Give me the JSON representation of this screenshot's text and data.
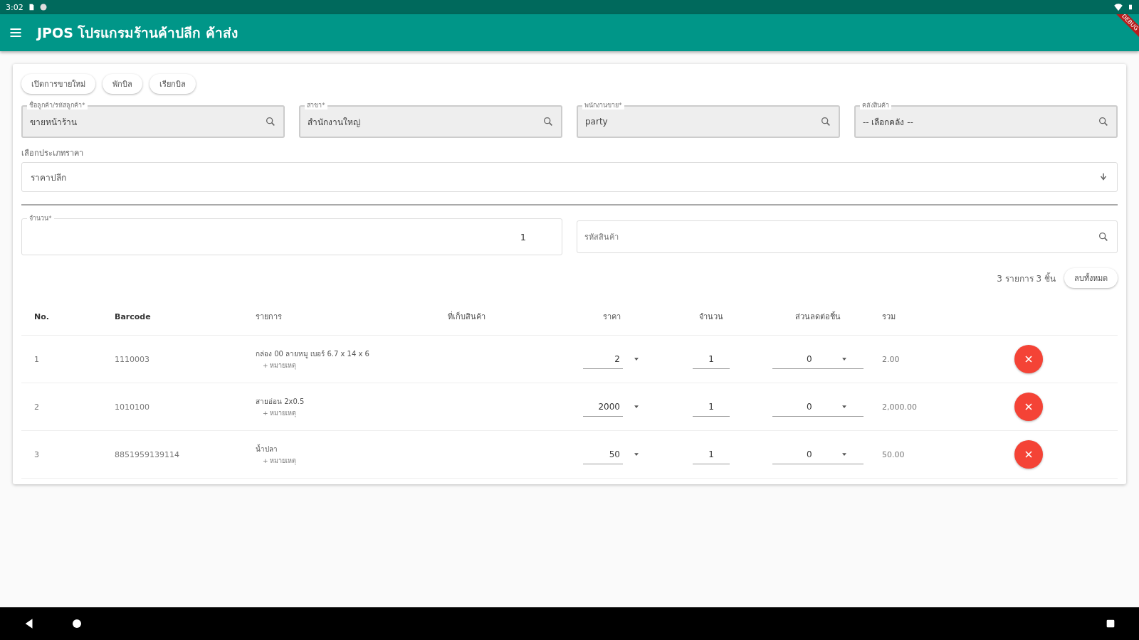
{
  "status_bar": {
    "time": "3:02"
  },
  "app_bar": {
    "title": "JPOS โปรแกรมร้านค้าปลีก ค้าส่ง",
    "banner": "DEBUG"
  },
  "actions": [
    "เปิดการขายใหม่",
    "พักบิล",
    "เรียกบิล"
  ],
  "fields": [
    {
      "label": "ชื่อลูกค้า/รหัสลูกค้า*",
      "value": "ขายหน้าร้าน"
    },
    {
      "label": "สาขา*",
      "value": "สำนักงานใหญ่"
    },
    {
      "label": "พนักงานขาย*",
      "value": "party"
    },
    {
      "label": "คลังสินค้า",
      "value": "-- เลือกคลัง --"
    }
  ],
  "price_type": {
    "label": "เลือกประเภทราคา",
    "value": "ราคาปลีก"
  },
  "quantity": {
    "label": "จำนวน*",
    "value": "1"
  },
  "search": {
    "placeholder": "รหัสสินค้า"
  },
  "summary": {
    "text": "3 รายการ 3 ชิ้น",
    "clear_button": "ลบทั้งหมด"
  },
  "table": {
    "columns": [
      "No.",
      "Barcode",
      "รายการ",
      "ที่เก็บสินค้า",
      "ราคา",
      "จำนวน",
      "ส่วนลดต่อชิ้น",
      "รวม"
    ],
    "rows": [
      {
        "no": "1",
        "barcode": "1110003",
        "name": "กล่อง 00 ลายหมู เบอร์ 6.7 x 14 x 6",
        "note": "+ หมายเหตุ",
        "price": "2",
        "qty": "1",
        "discount": "0",
        "total": "2.00"
      },
      {
        "no": "2",
        "barcode": "1010100",
        "name": "สายอ่อน 2x0.5",
        "note": "+ หมายเหตุ",
        "price": "2000",
        "qty": "1",
        "discount": "0",
        "total": "2,000.00"
      },
      {
        "no": "3",
        "barcode": "8851959139114",
        "name": "น้ำปลา",
        "note": "+ หมายเหตุ",
        "price": "50",
        "qty": "1",
        "discount": "0",
        "total": "50.00"
      }
    ]
  }
}
